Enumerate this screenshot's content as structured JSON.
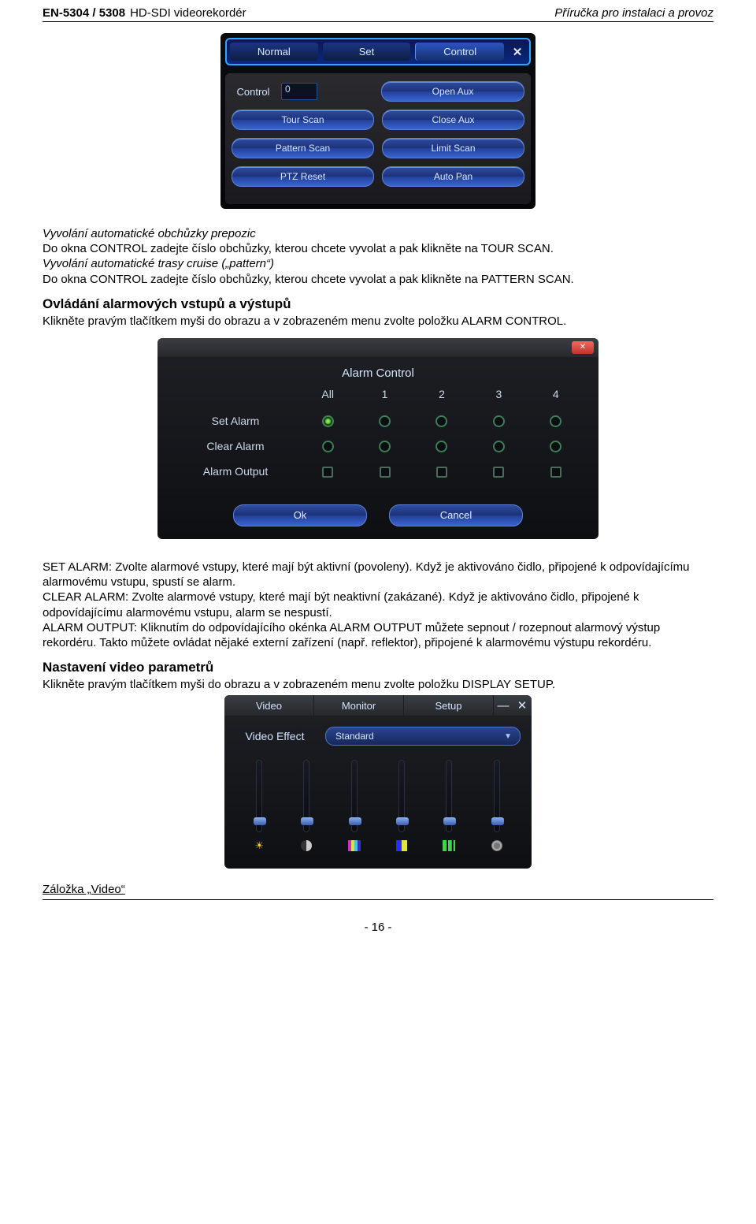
{
  "header": {
    "model": "EN-5304 / 5308",
    "product": "HD-SDI videorekordér",
    "manual": "Příručka pro instalaci a provoz"
  },
  "ptz": {
    "tabs": [
      "Normal",
      "Set",
      "Control"
    ],
    "close": "✕",
    "control_label": "Control",
    "control_value": "0",
    "buttons": {
      "open_aux": "Open Aux",
      "tour": "Tour Scan",
      "close_aux": "Close Aux",
      "pattern": "Pattern Scan",
      "limit": "Limit Scan",
      "ptzreset": "PTZ Reset",
      "autopan": "Auto Pan"
    }
  },
  "sec1": {
    "italic_title": "Vyvolání automatické obchůzky prepozic",
    "p1": "Do okna CONTROL zadejte číslo obchůzky, kterou chcete vyvolat a pak klikněte na TOUR SCAN.",
    "italic_title2": "Vyvolání automatické trasy cruise („pattern“)",
    "p2": "Do okna CONTROL zadejte číslo obchůzky, kterou chcete vyvolat a pak klikněte na PATTERN SCAN."
  },
  "alarm_section": {
    "h2": "Ovládání alarmových vstupů a výstupů",
    "p": "Klikněte pravým tlačítkem myši do obrazu a v zobrazeném menu zvolte položku ALARM CONTROL."
  },
  "alarm": {
    "title": "Alarm Control",
    "close": "✕",
    "cols": [
      "All",
      "1",
      "2",
      "3",
      "4"
    ],
    "rows": {
      "set": "Set Alarm",
      "clear": "Clear Alarm",
      "output": "Alarm Output"
    },
    "ok": "Ok",
    "cancel": "Cancel"
  },
  "alarm_desc": {
    "p1a": "SET ALARM: Zvolte alarmové vstupy, které mají být aktivní (povoleny). Když je aktivováno čidlo, připojené k odpovídajícímu alarmovému vstupu, spustí se alarm.",
    "p1b": "CLEAR ALARM: Zvolte alarmové vstupy, které mají být neaktivní (zakázané). Když je aktivováno čidlo, připojené k odpovídajícímu alarmovému vstupu, alarm se nespustí.",
    "p1c": "ALARM OUTPUT: Kliknutím do odpovídajícího okénka ALARM OUTPUT můžete sepnout / rozepnout alarmový výstup rekordéru. Takto můžete ovládat nějaké externí zařízení (např. reflektor), připojené k alarmovému výstupu rekordéru."
  },
  "display_section": {
    "h2": "Nastavení video parametrů",
    "p": "Klikněte pravým tlačítkem myši do obrazu a v zobrazeném menu zvolte položku DISPLAY SETUP."
  },
  "display": {
    "tabs": [
      "Video",
      "Monitor",
      "Setup"
    ],
    "min": "—",
    "close": "✕",
    "effect_label": "Video Effect",
    "effect_value": "Standard"
  },
  "footer_tab": "Záložka „Video“",
  "page_num": "- 16 -",
  "chart_data": {
    "type": "table",
    "title": "Alarm Control matrix",
    "columns": [
      "Row",
      "All",
      "1",
      "2",
      "3",
      "4"
    ],
    "rows": [
      [
        "Set Alarm",
        "selected",
        "unselected",
        "unselected",
        "unselected",
        "unselected"
      ],
      [
        "Clear Alarm",
        "unselected",
        "unselected",
        "unselected",
        "unselected",
        "unselected"
      ],
      [
        "Alarm Output",
        "unchecked",
        "unchecked",
        "unchecked",
        "unchecked",
        "unchecked"
      ]
    ]
  }
}
